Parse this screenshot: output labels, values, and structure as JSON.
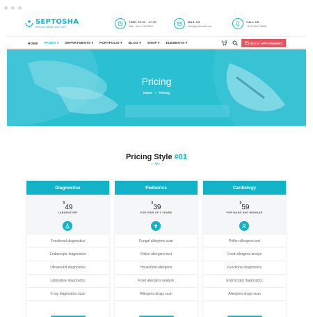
{
  "brand": {
    "name": "SEPTOSHA",
    "tagline": "Medical Health and Care"
  },
  "header_info": [
    {
      "title": "TIME: 09:00 - 17:00",
      "sub": "Sat - Sun: CLOSED"
    },
    {
      "title": "MAIL US",
      "sub": "info@yourmail.com"
    },
    {
      "title": "CALL US",
      "sub": "+123 4567 8900"
    }
  ],
  "nav": {
    "items": [
      "HOME",
      "PAGES",
      "DEPARTMENTS",
      "PORTFOLIO",
      "BLOG",
      "SHOP",
      "ELEMENTS"
    ],
    "active": "PAGES",
    "appointment": "BOOK APPOINMENT"
  },
  "hero": {
    "title": "Pricing",
    "breadcrumb": [
      "Home",
      "Pricing"
    ]
  },
  "section": {
    "title": "Pricing Style",
    "number": "#01"
  },
  "plans": [
    {
      "name": "Diagnostics",
      "currency": "$",
      "price": "49",
      "subtitle": "LABORATORY",
      "icon": "flask-icon",
      "features": [
        "Functional diagnostics",
        "Endoscopic diagnostics",
        "Ultrasound diagnostics",
        "Laboratory diagnostics",
        "X-ray diagnostics scan"
      ]
    },
    {
      "name": "Pediatrics",
      "currency": "$",
      "price": "39",
      "subtitle": "FOR KIDS OF 3 YEARS",
      "icon": "medical-cross-icon",
      "features": [
        "Fungal allergens scan",
        "Pollen allergens test",
        "Household allergens",
        "Food allergens analyze",
        "Allergens drugs scan"
      ]
    },
    {
      "name": "Cardiology",
      "currency": "$",
      "price": "59",
      "subtitle": "FOR MANS AND WOMANS",
      "icon": "user-icon",
      "features": [
        "Pollen allergens test",
        "Food allergens analyz",
        "Functional diagnostics",
        "Endoscopic diagnostics",
        "Allergens drugs scan"
      ]
    }
  ],
  "colors": {
    "accent": "#12b3c7",
    "cta": "#e9545e",
    "hero": "#2bbfd2"
  }
}
